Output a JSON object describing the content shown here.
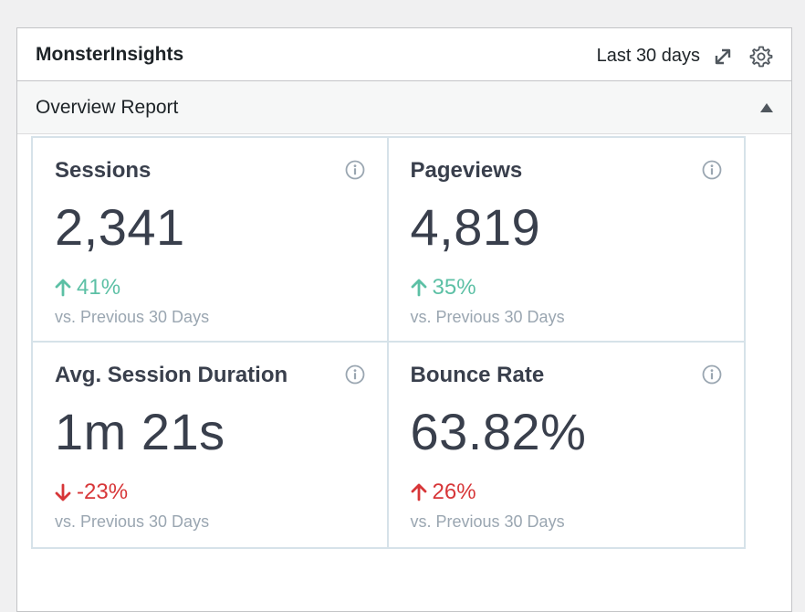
{
  "widget": {
    "title": "MonsterInsights",
    "date_range": "Last 30 days",
    "expand_icon": "expand-icon",
    "settings_icon": "gear-icon"
  },
  "subheader": {
    "title": "Overview Report",
    "toggle_icon": "triangle-up-icon"
  },
  "colors": {
    "positive": "#5cc0a5",
    "negative": "#d73638",
    "card_border": "#d6e2e9",
    "muted_text": "#9aa6b1"
  },
  "metrics": [
    {
      "label": "Sessions",
      "value": "2,341",
      "change": "41%",
      "direction": "up",
      "comparison": "vs. Previous 30 Days"
    },
    {
      "label": "Pageviews",
      "value": "4,819",
      "change": "35%",
      "direction": "up",
      "comparison": "vs. Previous 30 Days"
    },
    {
      "label": "Avg. Session Duration",
      "value": "1m 21s",
      "change": "-23%",
      "direction": "down",
      "comparison": "vs. Previous 30 Days"
    },
    {
      "label": "Bounce Rate",
      "value": "63.82%",
      "change": "26%",
      "direction": "up-negative",
      "comparison": "vs. Previous 30 Days"
    }
  ]
}
